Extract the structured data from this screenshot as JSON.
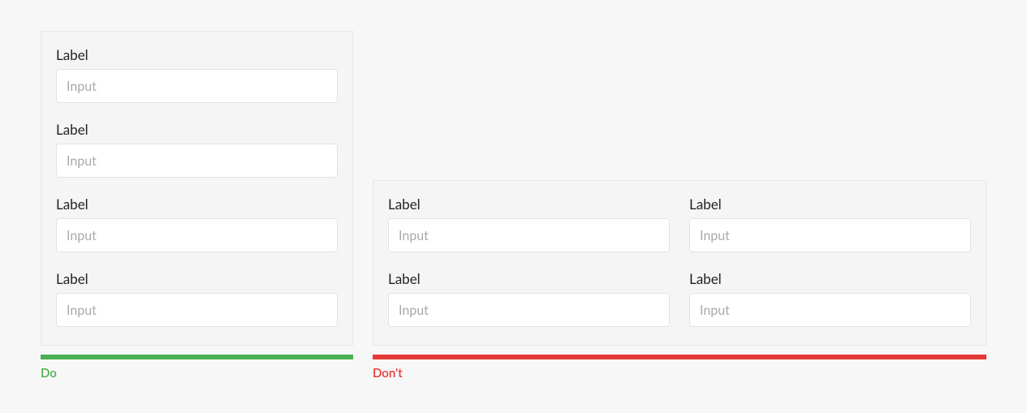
{
  "do_example": {
    "fields": [
      {
        "label": "Label",
        "placeholder": "Input"
      },
      {
        "label": "Label",
        "placeholder": "Input"
      },
      {
        "label": "Label",
        "placeholder": "Input"
      },
      {
        "label": "Label",
        "placeholder": "Input"
      }
    ],
    "caption": "Do",
    "accent": "#4caf50"
  },
  "dont_example": {
    "fields": [
      {
        "label": "Label",
        "placeholder": "Input"
      },
      {
        "label": "Label",
        "placeholder": "Input"
      },
      {
        "label": "Label",
        "placeholder": "Input"
      },
      {
        "label": "Label",
        "placeholder": "Input"
      }
    ],
    "caption": "Don't",
    "accent": "#e53935"
  }
}
